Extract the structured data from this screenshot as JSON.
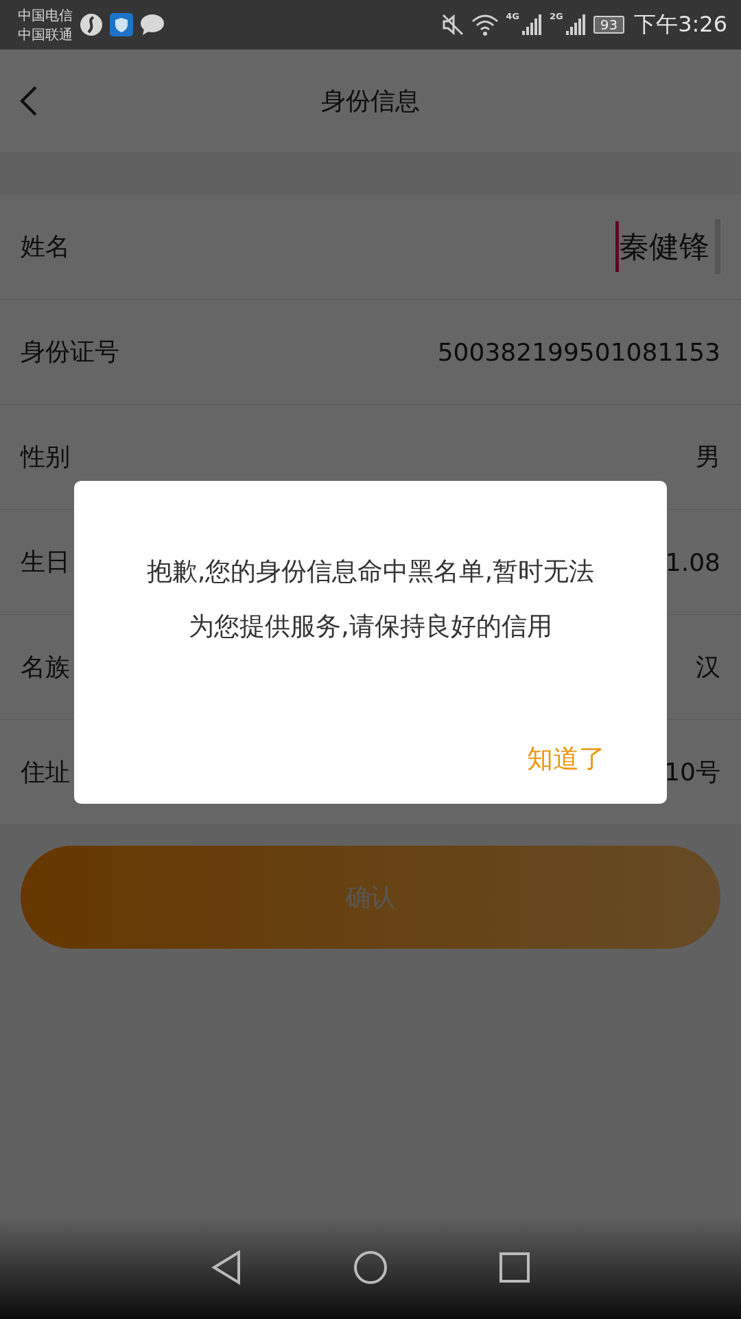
{
  "status_bar": {
    "carriers": [
      "中国电信",
      "中国联通"
    ],
    "network_labels": [
      "4G",
      "2G"
    ],
    "battery": "93",
    "time": "下午3:26"
  },
  "header": {
    "title": "身份信息"
  },
  "rows": [
    {
      "label": "姓名",
      "value": "秦健锋",
      "focused": true
    },
    {
      "label": "身份证号",
      "value": "500382199501081153",
      "focused": false
    },
    {
      "label": "性别",
      "value": "男",
      "focused": false
    },
    {
      "label": "生日",
      "value": "1.08",
      "focused": false
    },
    {
      "label": "名族",
      "value": "汉",
      "focused": false
    },
    {
      "label": "住址",
      "value": "10号",
      "focused": false
    }
  ],
  "confirm_button": {
    "label": "确认",
    "disabled": true
  },
  "dialog": {
    "message": "抱歉,您的身份信息命中黑名单,暂时无法为您提供服务,请保持良好的信用",
    "action": "知道了"
  }
}
